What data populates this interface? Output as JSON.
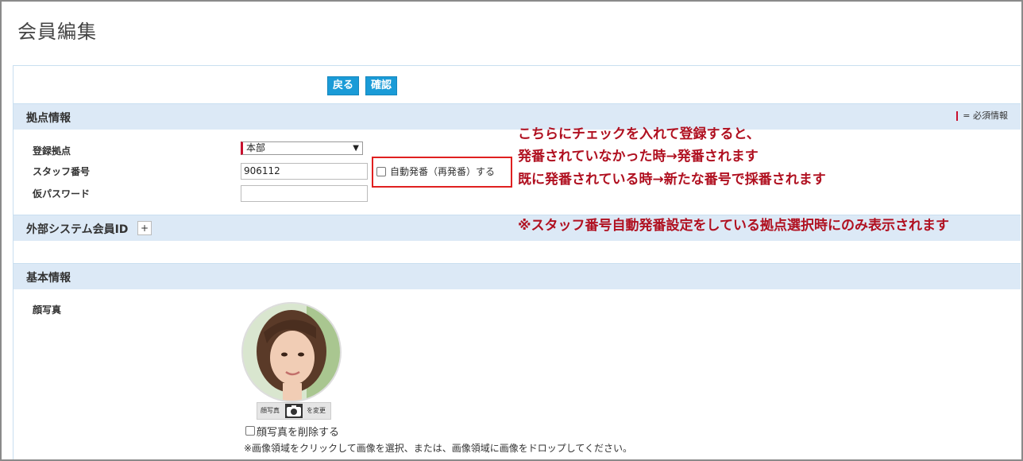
{
  "page": {
    "title": "会員編集"
  },
  "toolbar": {
    "back_label": "戻る",
    "confirm_label": "確認"
  },
  "sections": {
    "base": {
      "title": "拠点情報",
      "required_legend": "= 必須情報"
    },
    "external": {
      "title": "外部システム会員ID",
      "add_label": "+"
    },
    "basic": {
      "title": "基本情報"
    }
  },
  "fields": {
    "base_location": {
      "label": "登録拠点",
      "value": "本部"
    },
    "staff_number": {
      "label": "スタッフ番号",
      "value": "906112"
    },
    "auto_number": {
      "label": "自動発番（再発番）する",
      "checked": false
    },
    "temp_password": {
      "label": "仮パスワード",
      "value": ""
    },
    "face_photo": {
      "label": "顔写真",
      "change_left": "顔写真",
      "change_right": "を変更",
      "delete_label": "顔写真を削除する",
      "help_text": "※画像領域をクリックして画像を選択、または、画像領域に画像をドロップしてください。"
    }
  },
  "annotation": {
    "line1": "こちらにチェックを入れて登録すると、",
    "line2": "発番されていなかった時→発番されます",
    "line3": "既に発番されている時→新たな番号で採番されます",
    "line4": "※スタッフ番号自動発番設定をしている拠点選択時にのみ表示されます"
  },
  "colors": {
    "accent": "#1a9bd7",
    "section_bg": "#dce9f6",
    "required": "#c8102e",
    "annotation": "#b01020"
  },
  "icons": {
    "dropdown": "chevron-down-icon",
    "camera": "camera-icon"
  }
}
